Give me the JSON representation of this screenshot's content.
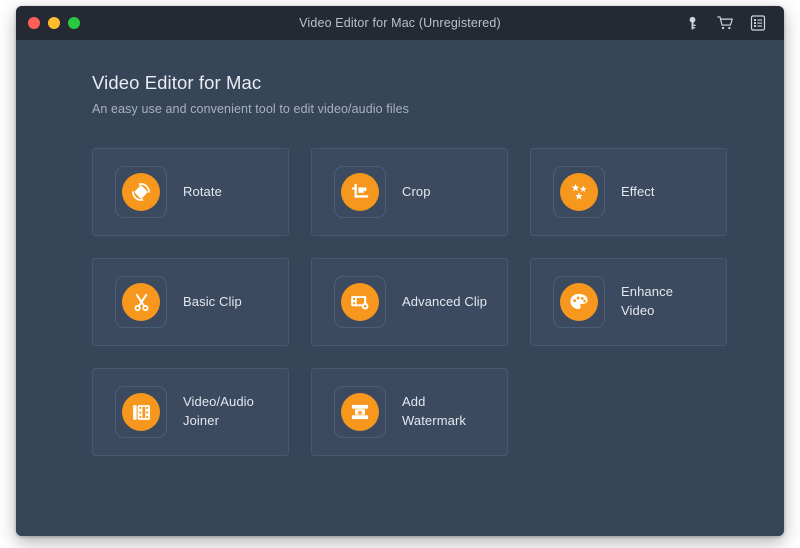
{
  "window": {
    "title": "Video Editor for Mac (Unregistered)",
    "traffic_lights": [
      {
        "name": "close",
        "color": "#ff5f57"
      },
      {
        "name": "minimize",
        "color": "#febc2e"
      },
      {
        "name": "maximize",
        "color": "#28c840"
      }
    ],
    "actions": [
      {
        "icon": "key-icon",
        "label": "Register"
      },
      {
        "icon": "cart-icon",
        "label": "Buy"
      },
      {
        "icon": "menu-icon",
        "label": "Menu"
      }
    ]
  },
  "header": {
    "title": "Video Editor for Mac",
    "subtitle": "An easy use and convenient tool to edit video/audio files"
  },
  "theme": {
    "accent": "#f7971d",
    "titlebar_bg": "#242933",
    "content_bg": "#374559",
    "card_bg": "#3b4a5f",
    "card_border": "#475872",
    "text_primary": "#e9edf3",
    "text_secondary": "#a7b2c2"
  },
  "features": [
    {
      "id": "rotate",
      "label": "Rotate",
      "icon": "rotate-icon"
    },
    {
      "id": "crop",
      "label": "Crop",
      "icon": "crop-icon"
    },
    {
      "id": "effect",
      "label": "Effect",
      "icon": "stars-icon"
    },
    {
      "id": "basic-clip",
      "label": "Basic Clip",
      "icon": "scissors-icon"
    },
    {
      "id": "advanced-clip",
      "label": "Advanced Clip",
      "icon": "advanced-clip-icon"
    },
    {
      "id": "enhance-video",
      "label": "Enhance\nVideo",
      "icon": "palette-icon"
    },
    {
      "id": "joiner",
      "label": "Video/Audio\nJoiner",
      "icon": "film-strip-icon"
    },
    {
      "id": "watermark",
      "label": "Add\nWatermark",
      "icon": "watermark-icon"
    }
  ]
}
